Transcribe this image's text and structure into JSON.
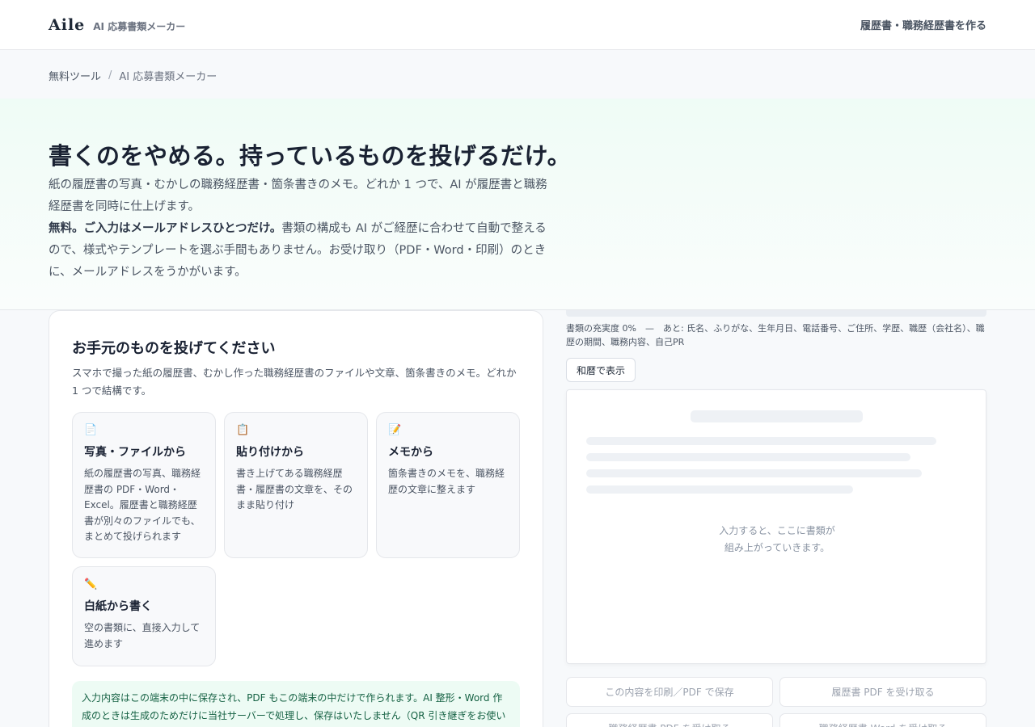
{
  "header": {
    "logo": "Aile",
    "subtitle": "AI 応募書類メーカー",
    "cta": "履歴書・職務経歴書を作る"
  },
  "breadcrumb": {
    "home": "無料ツール",
    "separator": "/",
    "current": "AI 応募書類メーカー"
  },
  "hero": {
    "title": "書くのをやめる。持っているものを投げるだけ。",
    "line1": "紙の履歴書の写真・むかしの職務経歴書・箇条書きのメモ。どれか 1 つで、AI が履歴書と職務経歴書を同時に仕上げます。",
    "bold": "無料。ご入力はメールアドレスひとつだけ。",
    "line2": "書類の構成も AI がご経歴に合わせて自動で整えるので、様式やテンプレートを選ぶ手間もありません。お受け取り（PDF・Word・印刷）のときに、メールアドレスをうかがいます。"
  },
  "input_card": {
    "title": "お手元のものを投げてください",
    "description": "スマホで撮った紙の履歴書、むかし作った職務経歴書のファイルや文章、箇条書きのメモ。どれか 1 つで結構です。",
    "options": [
      {
        "icon": "📄",
        "title": "写真・ファイルから",
        "desc": "紙の履歴書の写真、職務経歴書の PDF・Word・Excel。履歴書と職務経歴書が別々のファイルでも、まとめて投げられます"
      },
      {
        "icon": "📋",
        "title": "貼り付けから",
        "desc": "書き上げてある職務経歴書・履歴書の文章を、そのまま貼り付け"
      },
      {
        "icon": "📝",
        "title": "メモから",
        "desc": "箇条書きのメモを、職務経歴の文章に整えます"
      },
      {
        "icon": "✏️",
        "title": "白紙から書く",
        "desc": "空の書類に、直接入力して進めます"
      }
    ],
    "notice": "入力内容はこの端末の中に保存され、PDF もこの端末の中だけで作られます。AI 整形・Word 作成のときは生成のためだけに当社サーバーで処理し、保存はいたしません（QR 引き継ぎをお使いの場合のみ"
  },
  "preview_panel": {
    "completion": 0,
    "status_text": "書類の充実度 0%　—　あと: 氏名、ふりがな、生年月日、電話番号、ご住所、学歴、職歴（会社名）、職歴の期間、職務内容、自己PR",
    "wareki_button": "和暦で表示",
    "placeholder_line1": "入力すると、ここに書類が",
    "placeholder_line2": "組み上がっていきます。",
    "actions": [
      "この内容を印刷／PDF で保存",
      "履歴書 PDF を受け取る",
      "職務経歴書 PDF を受け取る",
      "職務経歴書 Word を受け取る"
    ]
  },
  "colors": {
    "accent": "#10b981",
    "hero_bg": "#effcf6",
    "notice_bg": "#edfbf4",
    "notice_text": "#166244"
  }
}
